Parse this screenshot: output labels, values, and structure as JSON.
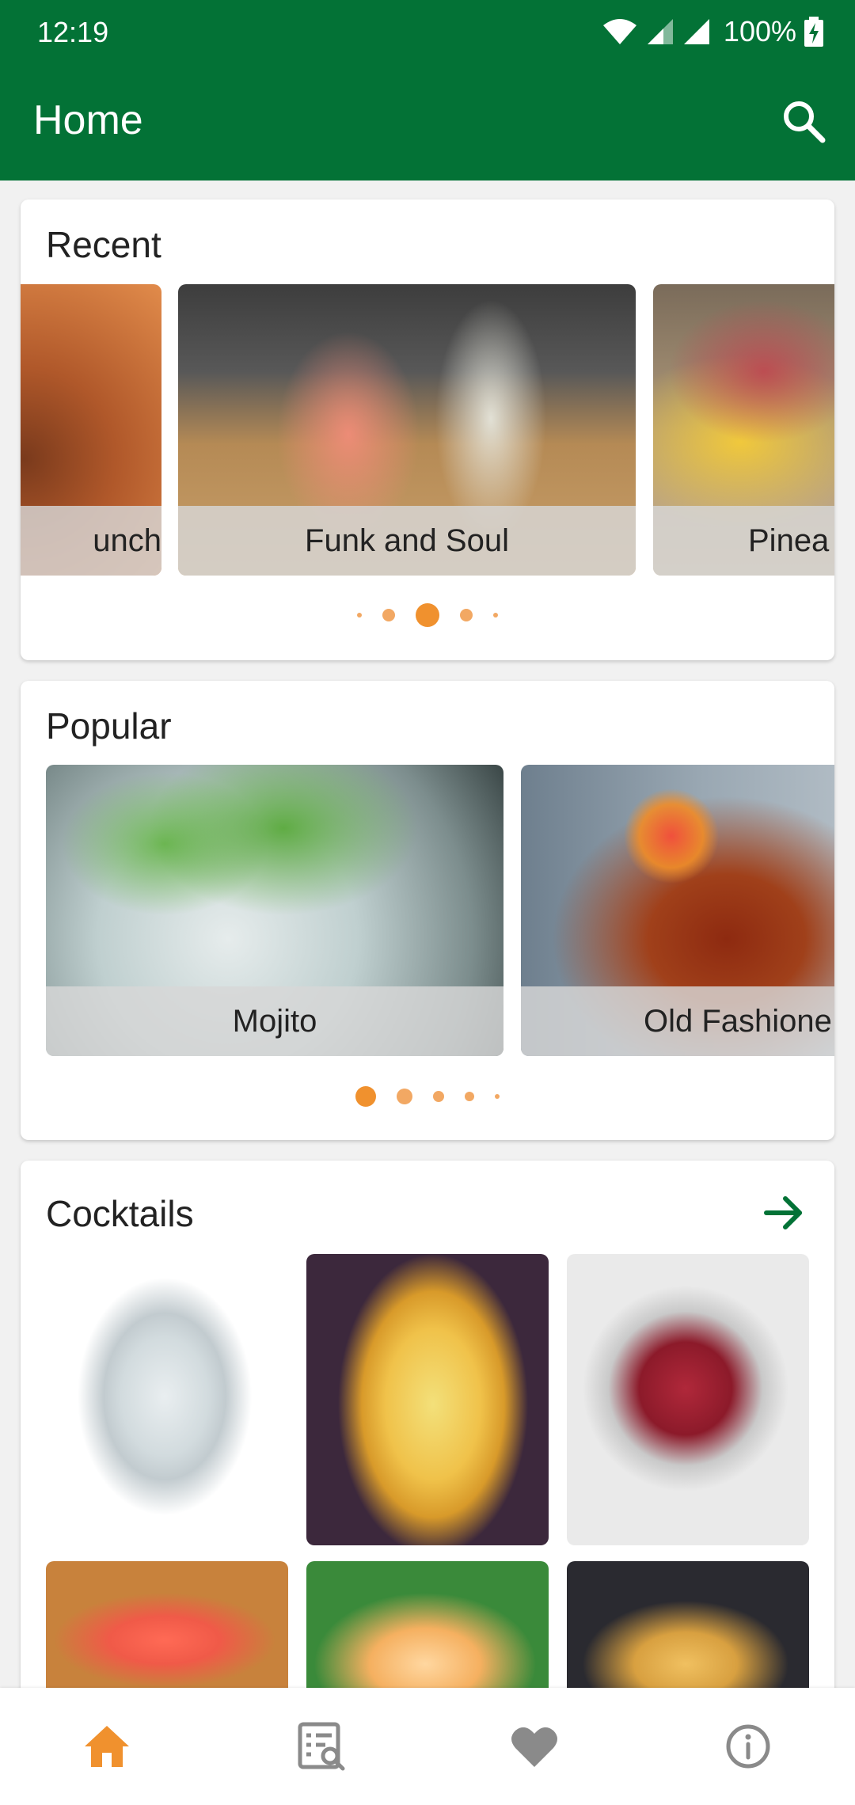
{
  "status_bar": {
    "time": "12:19",
    "battery": "100%"
  },
  "app_bar": {
    "title": "Home"
  },
  "recent": {
    "title": "Recent",
    "slides": [
      {
        "label": "unch"
      },
      {
        "label": "Funk and Soul"
      },
      {
        "label": "Pinea"
      }
    ],
    "dots_active_index": 2
  },
  "popular": {
    "title": "Popular",
    "slides": [
      {
        "label": "Mojito"
      },
      {
        "label": "Old Fashione"
      }
    ],
    "dots_active_index": 0
  },
  "cocktails": {
    "title": "Cocktails"
  },
  "colors": {
    "primary": "#037236",
    "accent": "#f0912e",
    "dot": "#f2a863"
  },
  "nav": [
    "home-icon",
    "search-list-icon",
    "heart-icon",
    "info-icon"
  ]
}
